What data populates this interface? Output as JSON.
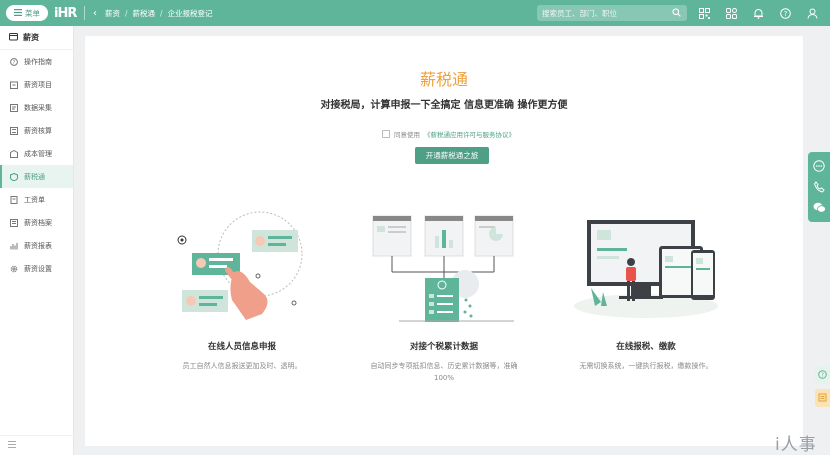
{
  "topbar": {
    "menu_label": "菜单",
    "logo_text": "iHR",
    "breadcrumb": [
      "薪资",
      "薪税通",
      "企业报税登记"
    ],
    "search_placeholder": "搜索员工、部门、职位",
    "icons": [
      "qrcode-icon",
      "apps-icon",
      "bell-icon",
      "help-icon",
      "user-icon"
    ]
  },
  "sidebar": {
    "header": "薪资",
    "items": [
      {
        "label": "操作指南",
        "icon": "guide-icon"
      },
      {
        "label": "薪资项目",
        "icon": "folder-icon"
      },
      {
        "label": "数据采集",
        "icon": "data-icon"
      },
      {
        "label": "薪资核算",
        "icon": "calc-icon"
      },
      {
        "label": "成本管理",
        "icon": "cost-icon"
      },
      {
        "label": "薪税通",
        "icon": "tax-icon",
        "active": true
      },
      {
        "label": "工资单",
        "icon": "payslip-icon"
      },
      {
        "label": "薪资档案",
        "icon": "archive-icon"
      },
      {
        "label": "薪资报表",
        "icon": "report-icon"
      },
      {
        "label": "薪资设置",
        "icon": "settings-icon"
      }
    ]
  },
  "main": {
    "title": "薪税通",
    "subtitle": "对接税局，计算申报一下全搞定 信息更准确 操作更方便",
    "agree_prefix": "同意使用",
    "agree_link": "《薪税通应用许可与服务协议》",
    "open_button": "开通薪税通之旅",
    "features": [
      {
        "title": "在线人员信息申报",
        "desc": "员工自然人信息报送更加及时、透明。"
      },
      {
        "title": "对接个税累计数据",
        "desc": "自动同步专项抵扣信息、历史累计数据等，准确100%"
      },
      {
        "title": "在线报税、缴款",
        "desc": "无需切换系统，一键执行报税，缴款操作。"
      }
    ]
  },
  "watermark": "i人事",
  "colors": {
    "brand": "#5fb59a",
    "accent": "#f0a03c",
    "button": "#4f9e86"
  }
}
